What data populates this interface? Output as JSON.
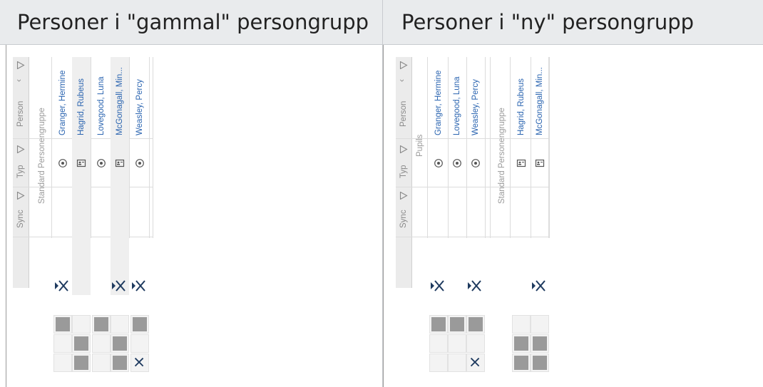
{
  "panels": {
    "left": {
      "title": "Personer i \"gammal\" persongrupp",
      "header_labels": {
        "person": "Person",
        "typ": "Typ",
        "sync": "Sync"
      },
      "groups": [
        "Standard Personengruppe"
      ],
      "persons": [
        {
          "name": "Granger, Hermine",
          "type": "card-icon"
        },
        {
          "name": "Hagrid, Rubeus",
          "type": "badge-icon"
        },
        {
          "name": "Lovegood, Luna",
          "type": "card-icon"
        },
        {
          "name": "McGonagall, Min...",
          "type": "badge-icon"
        },
        {
          "name": "Weasley, Percy",
          "type": "card-icon"
        }
      ],
      "access_row": [
        true,
        false,
        false,
        true,
        true
      ],
      "grid": [
        [
          true,
          false,
          true,
          false,
          true
        ],
        [
          false,
          true,
          false,
          true,
          false
        ],
        [
          false,
          true,
          false,
          true,
          "x"
        ]
      ]
    },
    "right": {
      "title": "Personer i \"ny\" persongrupp",
      "header_labels": {
        "person": "Person",
        "typ": "Typ",
        "sync": "Sync"
      },
      "groups": [
        "Pupils",
        "Standard Personengruppe"
      ],
      "persons": [
        {
          "name": "Granger, Hermine",
          "type": "card-icon",
          "group": "Pupils"
        },
        {
          "name": "Lovegood, Luna",
          "type": "card-icon",
          "group": "Pupils"
        },
        {
          "name": "Weasley, Percy",
          "type": "card-icon",
          "group": "Pupils"
        },
        {
          "name": "Hagrid, Rubeus",
          "type": "badge-icon",
          "group": "Standard Personengruppe"
        },
        {
          "name": "McGonagall, Min...",
          "type": "badge-icon",
          "group": "Standard Personengruppe"
        }
      ],
      "access_row": [
        true,
        false,
        true,
        false,
        true
      ],
      "grid": [
        [
          true,
          true,
          true,
          false,
          false
        ],
        [
          false,
          false,
          false,
          true,
          true
        ],
        [
          false,
          false,
          "x",
          true,
          true
        ]
      ]
    }
  },
  "colors": {
    "name_blue": "#2a64b0",
    "x_mark": "#1e3a5f",
    "square": "#9a9a9a"
  }
}
